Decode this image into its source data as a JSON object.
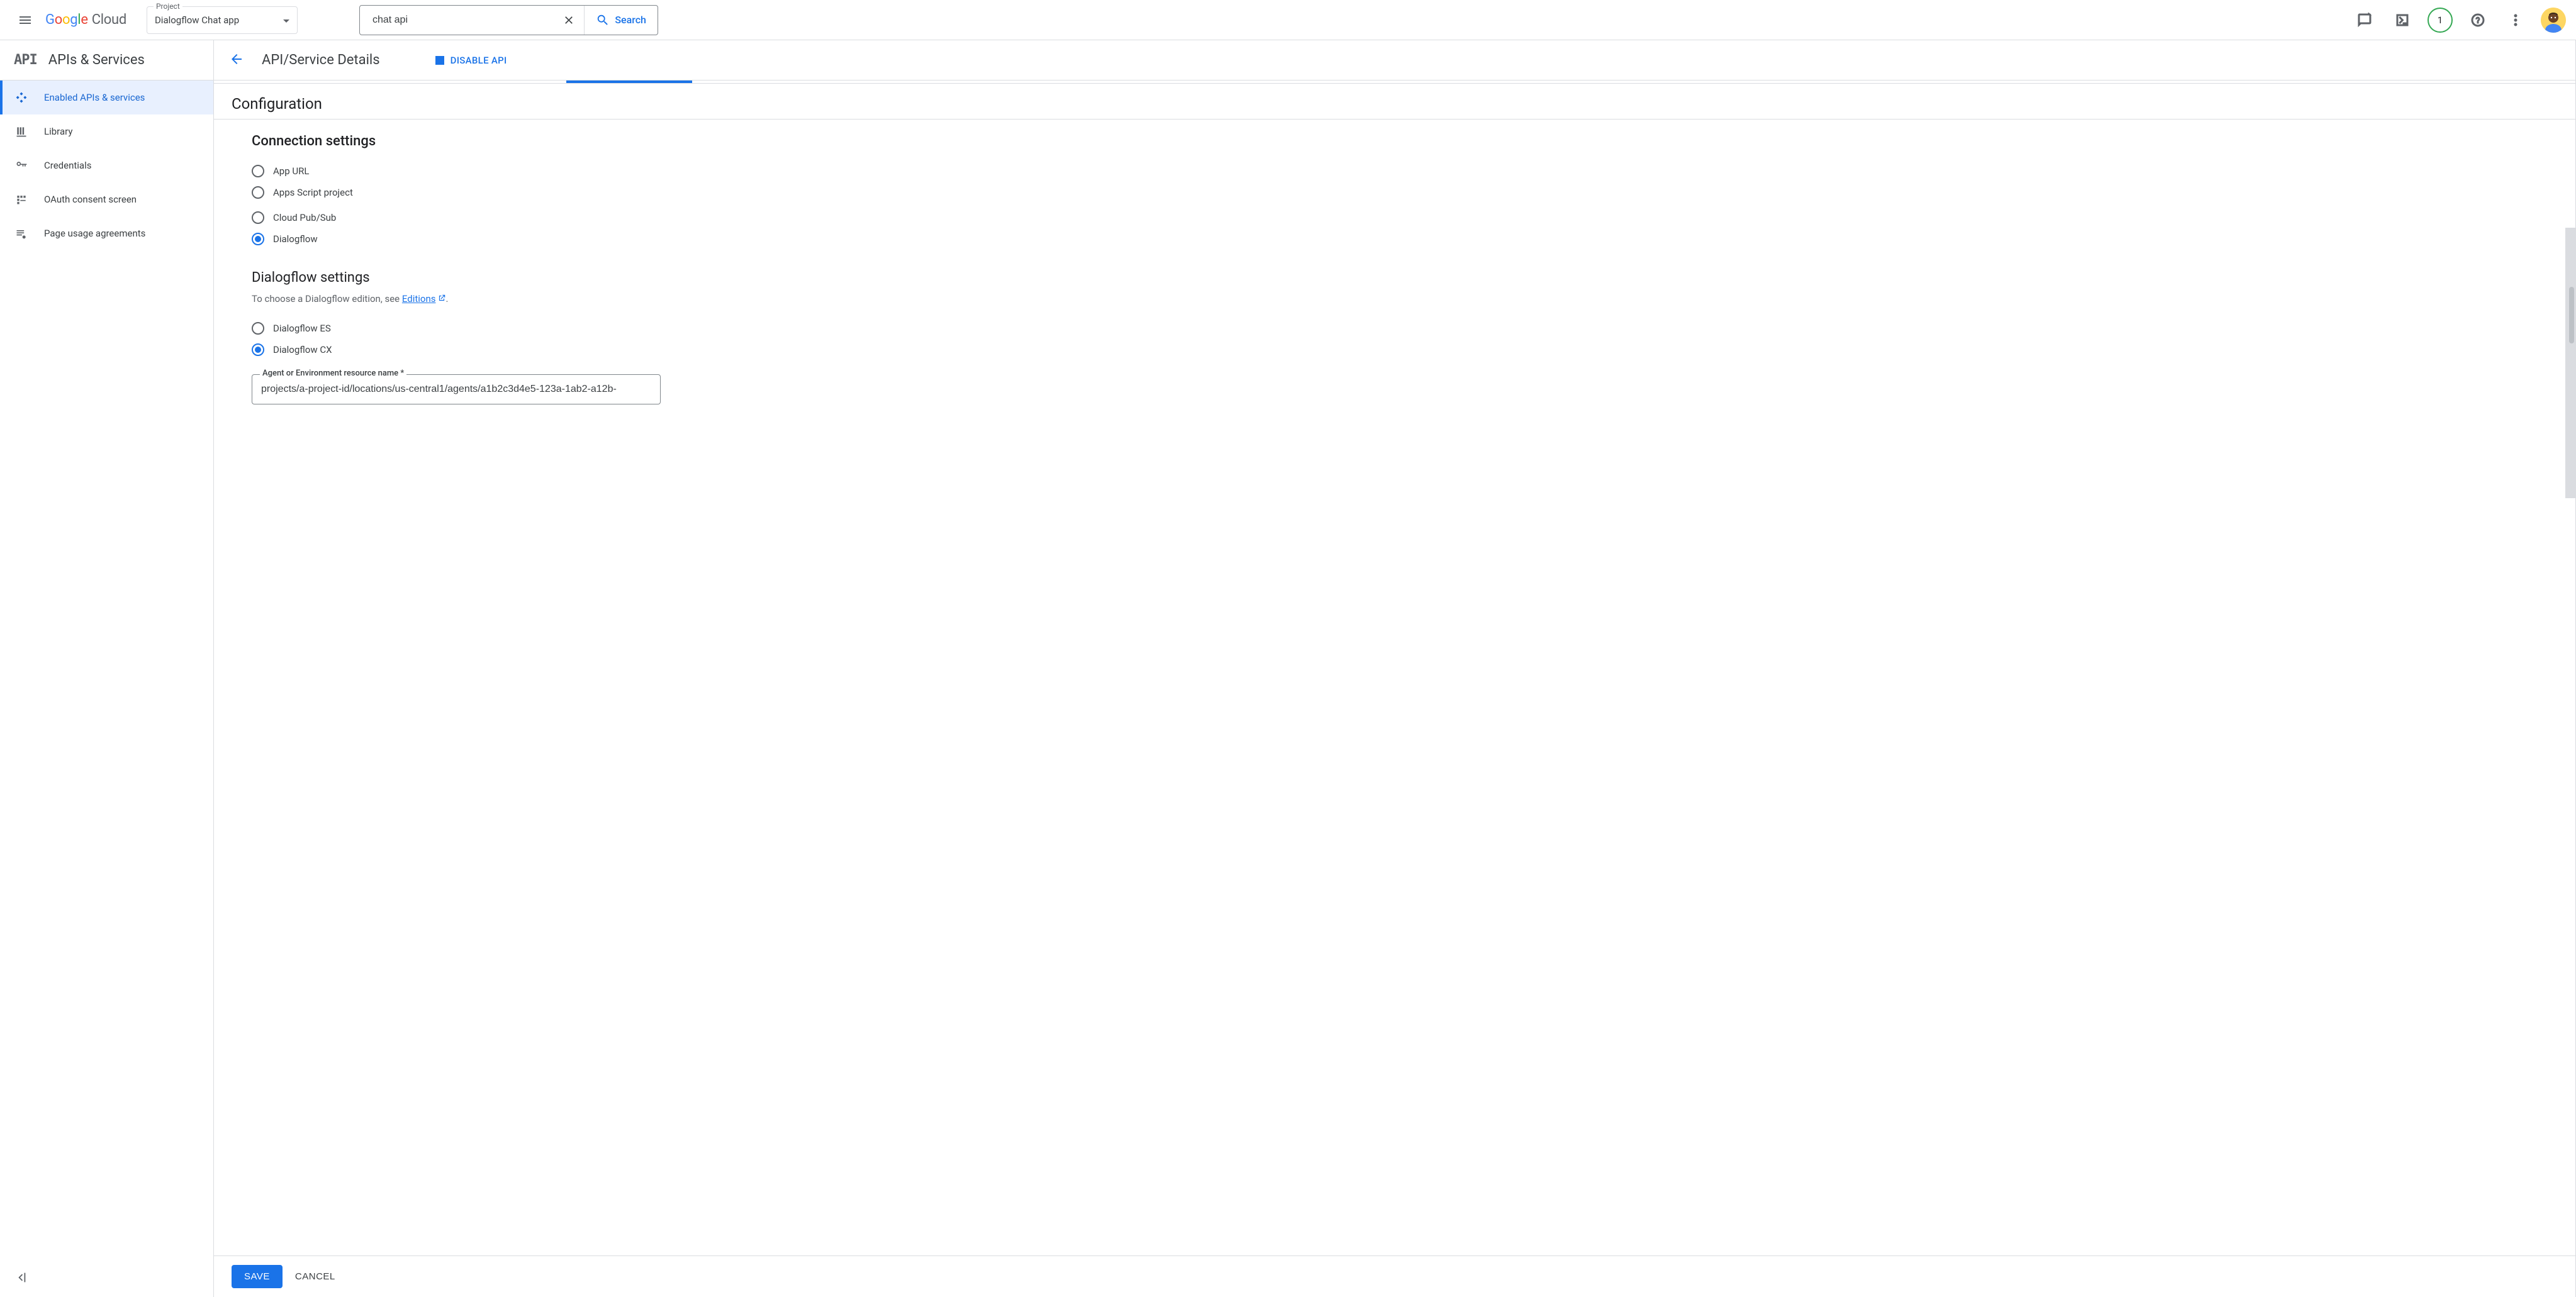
{
  "topbar": {
    "logo_cloud": "Cloud",
    "project_label": "Project",
    "project_value": "Dialogflow Chat app",
    "search_value": "chat api",
    "search_button": "Search",
    "notif_count": "1"
  },
  "sidebar": {
    "title": "APIs & Services",
    "api_mark": "API",
    "items": [
      {
        "label": "Enabled APIs & services",
        "icon": "diamond"
      },
      {
        "label": "Library",
        "icon": "library"
      },
      {
        "label": "Credentials",
        "icon": "key"
      },
      {
        "label": "OAuth consent screen",
        "icon": "consent"
      },
      {
        "label": "Page usage agreements",
        "icon": "agreements"
      }
    ]
  },
  "main": {
    "title": "API/Service Details",
    "disable": "DISABLE API",
    "config_title": "Configuration",
    "conn_title": "Connection settings",
    "conn_options": [
      "App URL",
      "Apps Script project",
      "Cloud Pub/Sub",
      "Dialogflow"
    ],
    "conn_selected": "Dialogflow",
    "df_title": "Dialogflow settings",
    "df_helper_pre": "To choose a Dialogflow edition, see ",
    "df_helper_link": "Editions",
    "df_options": [
      "Dialogflow ES",
      "Dialogflow CX"
    ],
    "df_selected": "Dialogflow CX",
    "field_label": "Agent or Environment resource name *",
    "field_value": "projects/a-project-id/locations/us-central1/agents/a1b2c3d4e5-123a-1ab2-a12b-",
    "save": "SAVE",
    "cancel": "CANCEL"
  }
}
